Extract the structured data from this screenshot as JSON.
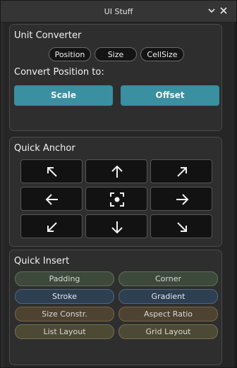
{
  "window": {
    "title": "UI Stuff",
    "chevron_icon": "chevron-down-icon",
    "close_icon": "close-icon"
  },
  "unit_converter": {
    "title": "Unit Converter",
    "modes": [
      {
        "label": "Position"
      },
      {
        "label": "Size"
      },
      {
        "label": "CellSize"
      }
    ],
    "convert_label": "Convert Position to:",
    "buttons": [
      {
        "label": "Scale"
      },
      {
        "label": "Offset"
      }
    ],
    "accent_color": "#3a8fa0"
  },
  "quick_anchor": {
    "title": "Quick Anchor",
    "buttons": [
      {
        "icon": "arrow-up-left-icon"
      },
      {
        "icon": "arrow-up-icon"
      },
      {
        "icon": "arrow-up-right-icon"
      },
      {
        "icon": "arrow-left-icon"
      },
      {
        "icon": "center-focus-icon"
      },
      {
        "icon": "arrow-right-icon"
      },
      {
        "icon": "arrow-down-left-icon"
      },
      {
        "icon": "arrow-down-icon"
      },
      {
        "icon": "arrow-down-right-icon"
      }
    ]
  },
  "quick_insert": {
    "title": "Quick Insert",
    "items": [
      {
        "label": "Padding",
        "color": "#3d4a3b"
      },
      {
        "label": "Corner",
        "color": "#3d4a3b"
      },
      {
        "label": "Stroke",
        "color": "#2e3f52"
      },
      {
        "label": "Gradient",
        "color": "#2e3f52"
      },
      {
        "label": "Size Constr.",
        "color": "#4e4230"
      },
      {
        "label": "Aspect Ratio",
        "color": "#4e4230"
      },
      {
        "label": "List Layout",
        "color": "#4c4a34"
      },
      {
        "label": "Grid Layout",
        "color": "#4c4a34"
      }
    ]
  }
}
